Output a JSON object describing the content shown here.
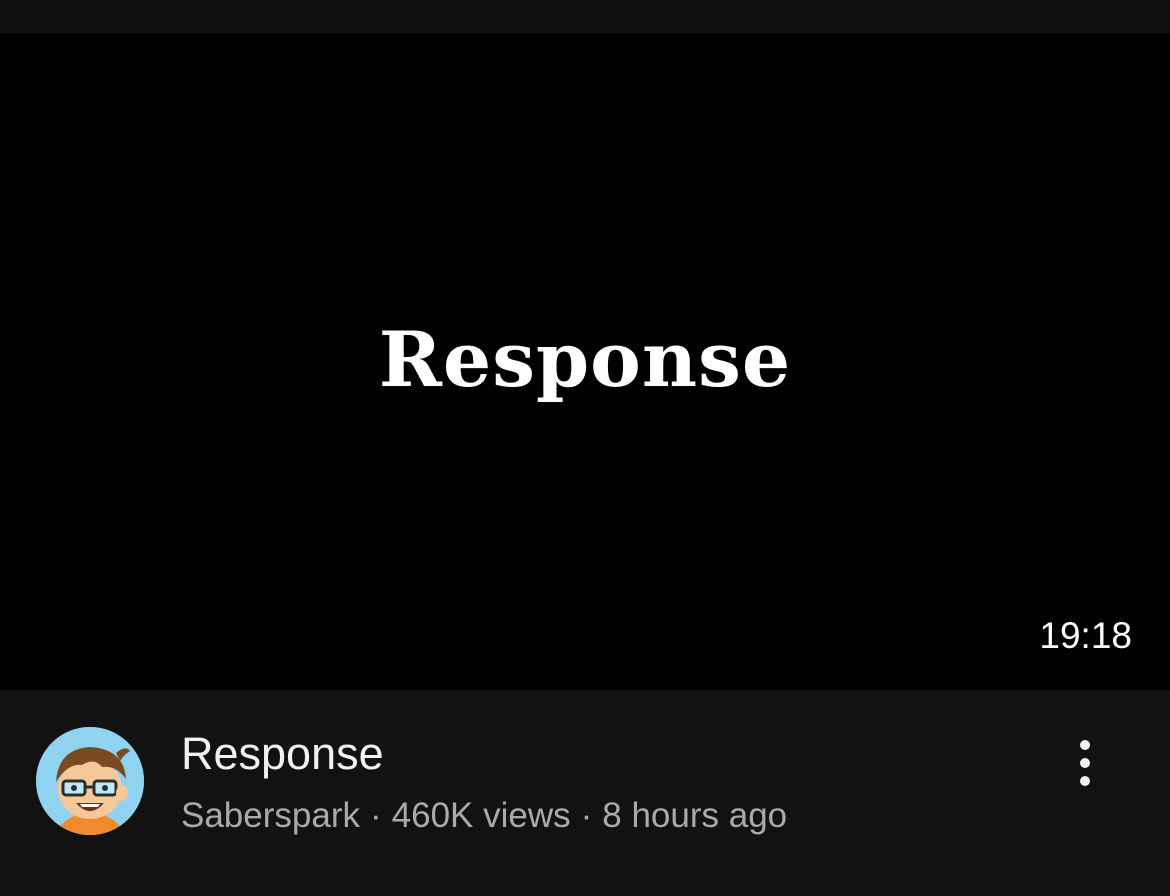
{
  "video": {
    "thumbnail_text": "Response",
    "duration": "19:18",
    "title": "Response",
    "channel": "Saberspark",
    "separator": "·",
    "views": "460K views",
    "age": "8 hours ago"
  },
  "icons": {
    "more": "vertical-ellipsis-icon",
    "avatar": "channel-avatar"
  },
  "colors": {
    "background": "#0f0f0f",
    "thumbnail_bg": "#000000",
    "title_text": "#f1f1f1",
    "meta_text": "#aaaaaa"
  }
}
